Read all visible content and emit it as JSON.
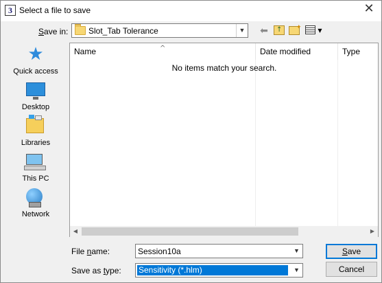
{
  "window": {
    "title": "Select a file to save",
    "app_icon_text": "3",
    "close_glyph": "✕"
  },
  "toolbar": {
    "save_in_label": "Save in:",
    "save_in_value": "Slot_Tab Tolerance",
    "icons": [
      "back-arrow-icon",
      "up-folder-icon",
      "new-folder-icon",
      "view-menu-icon"
    ]
  },
  "places": [
    {
      "label": "Quick access",
      "icon": "star-icon"
    },
    {
      "label": "Desktop",
      "icon": "desktop-icon"
    },
    {
      "label": "Libraries",
      "icon": "libraries-icon"
    },
    {
      "label": "This PC",
      "icon": "computer-icon"
    },
    {
      "label": "Network",
      "icon": "network-icon"
    }
  ],
  "file_list": {
    "columns": [
      "Name",
      "Date modified",
      "Type"
    ],
    "empty_message": "No items match your search."
  },
  "form": {
    "file_name_label": "File name:",
    "file_name_value": "Session10a",
    "save_as_type_label": "Save as type:",
    "save_as_type_value": "Sensitivity (*.hlm)",
    "save_button": "Save",
    "cancel_button": "Cancel"
  },
  "colors": {
    "accent": "#0078d7",
    "window_bg": "#f0f0f0"
  }
}
